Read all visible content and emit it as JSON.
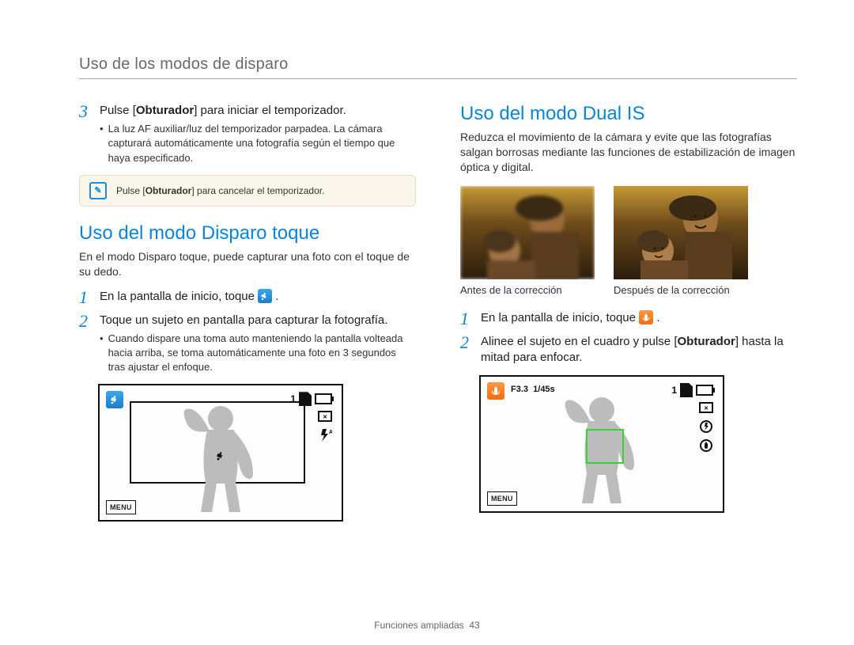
{
  "sectionHeader": "Uso de los modos de disparo",
  "left": {
    "step3": {
      "main_pre": "Pulse [",
      "main_bold": "Obturador",
      "main_post": "] para iniciar el temporizador.",
      "bullet": "La luz AF auxiliar/luz del temporizador parpadea. La cámara capturará automáticamente una fotografía según el tiempo que haya especificado."
    },
    "note_pre": "Pulse [",
    "note_bold": "Obturador",
    "note_post": "] para cancelar el temporizador.",
    "h2": "Uso del modo Disparo toque",
    "intro": "En el modo Disparo toque, puede capturar una foto con el toque de su dedo.",
    "step1_text": "En la pantalla de inicio, toque ",
    "step2_main": "Toque un sujeto en pantalla para capturar la fotografía.",
    "step2_bullet": "Cuando dispare una toma auto manteniendo la pantalla volteada hacia arriba, se toma automáticamente una foto en 3 segundos tras ajustar el enfoque.",
    "lcd": {
      "shots": "1",
      "flash": "A",
      "menu": "MENU"
    }
  },
  "right": {
    "h2": "Uso del modo Dual IS",
    "intro": "Reduzca el movimiento de la cámara y evite que las fotografías salgan borrosas mediante las funciones de estabilización de imagen óptica y digital.",
    "before": "Antes de la corrección",
    "after": "Después de la corrección",
    "step1_text": "En la pantalla de inicio, toque ",
    "step2_pre": "Alinee el sujeto en el cuadro y pulse [",
    "step2_bold": "Obturador",
    "step2_post": "] hasta la mitad para enfocar.",
    "lcd": {
      "aperture": "F3.3",
      "shutter": "1/45s",
      "shots": "1",
      "menu": "MENU"
    }
  },
  "footer": {
    "label": "Funciones ampliadas",
    "page": "43"
  }
}
